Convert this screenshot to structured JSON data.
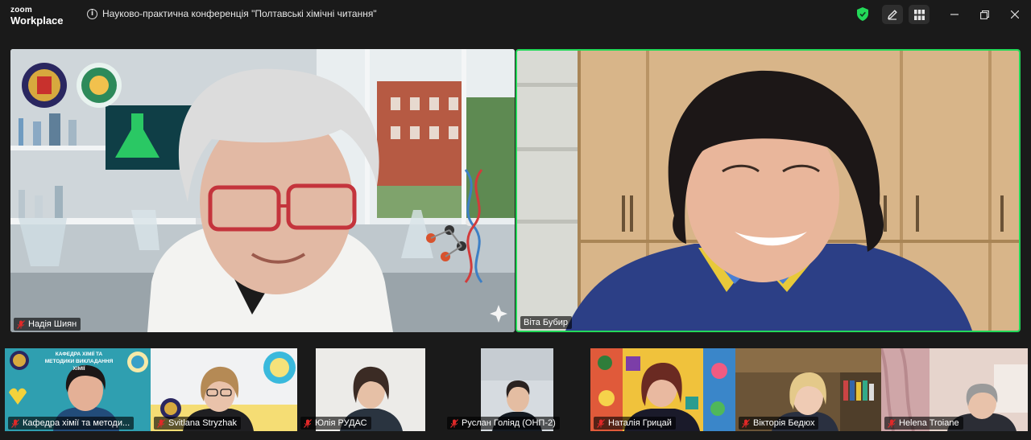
{
  "app": {
    "brand_line1": "zoom",
    "brand_line2": "Workplace",
    "meeting_title": "Науково-практична конференція \"Полтавські хімічні читання\""
  },
  "toolbar": {
    "icons": [
      "shield-check-icon",
      "annotate-pen-icon",
      "grid-view-icon"
    ],
    "window_controls": [
      "minimize-icon",
      "restore-icon",
      "close-icon"
    ],
    "accent_green": "#23d959"
  },
  "main_tiles": [
    {
      "name": "Надія Шиян",
      "muted": true,
      "active_speaker": false
    },
    {
      "name": "Віта Бубир",
      "muted": false,
      "active_speaker": true
    }
  ],
  "strip_tiles": [
    {
      "name": "Кафедра хімії та методи...",
      "muted": true,
      "banner": "КАФЕДРА ХІМІЇ ТА МЕТОДИКИ ВИКЛАДАННЯ ХІМІЇ"
    },
    {
      "name": "Svitlana Stryzhak",
      "muted": true
    },
    {
      "name": "Юлія РУДАС",
      "muted": true
    },
    {
      "name": "Руслан Голіяд (ОНП-2)",
      "muted": true
    },
    {
      "name": "Наталія Грицай",
      "muted": true
    },
    {
      "name": "Вікторія Бедюх",
      "muted": true
    },
    {
      "name": "Helena Troiane",
      "muted": true
    }
  ]
}
